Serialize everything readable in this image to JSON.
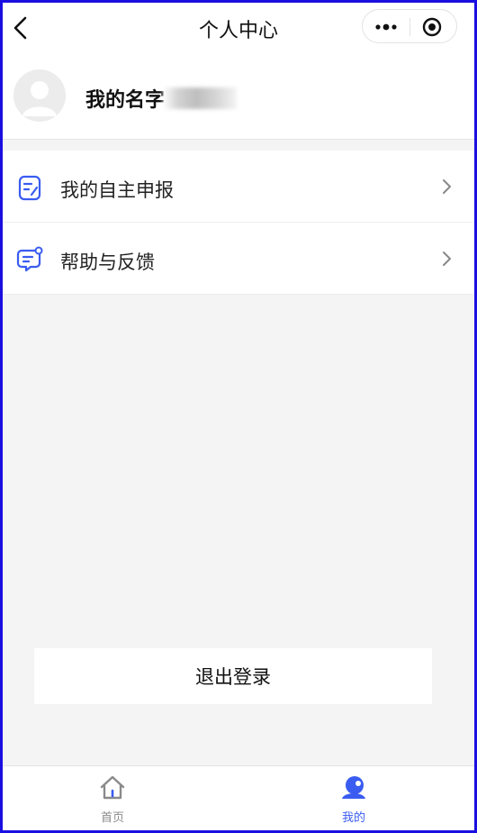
{
  "navbar": {
    "title": "个人中心"
  },
  "profile": {
    "name": "我的名字"
  },
  "menu": {
    "items": [
      {
        "label": "我的自主申报",
        "icon": "edit-document-icon"
      },
      {
        "label": "帮助与反馈",
        "icon": "chat-bubble-icon"
      }
    ]
  },
  "logout": {
    "label": "退出登录"
  },
  "tabbar": {
    "tabs": [
      {
        "label": "首页",
        "icon": "home-icon",
        "active": false
      },
      {
        "label": "我的",
        "icon": "user-icon",
        "active": true
      }
    ]
  },
  "colors": {
    "accent": "#3a5cf0",
    "border": "#1a0fe0",
    "background": "#f4f4f4"
  }
}
